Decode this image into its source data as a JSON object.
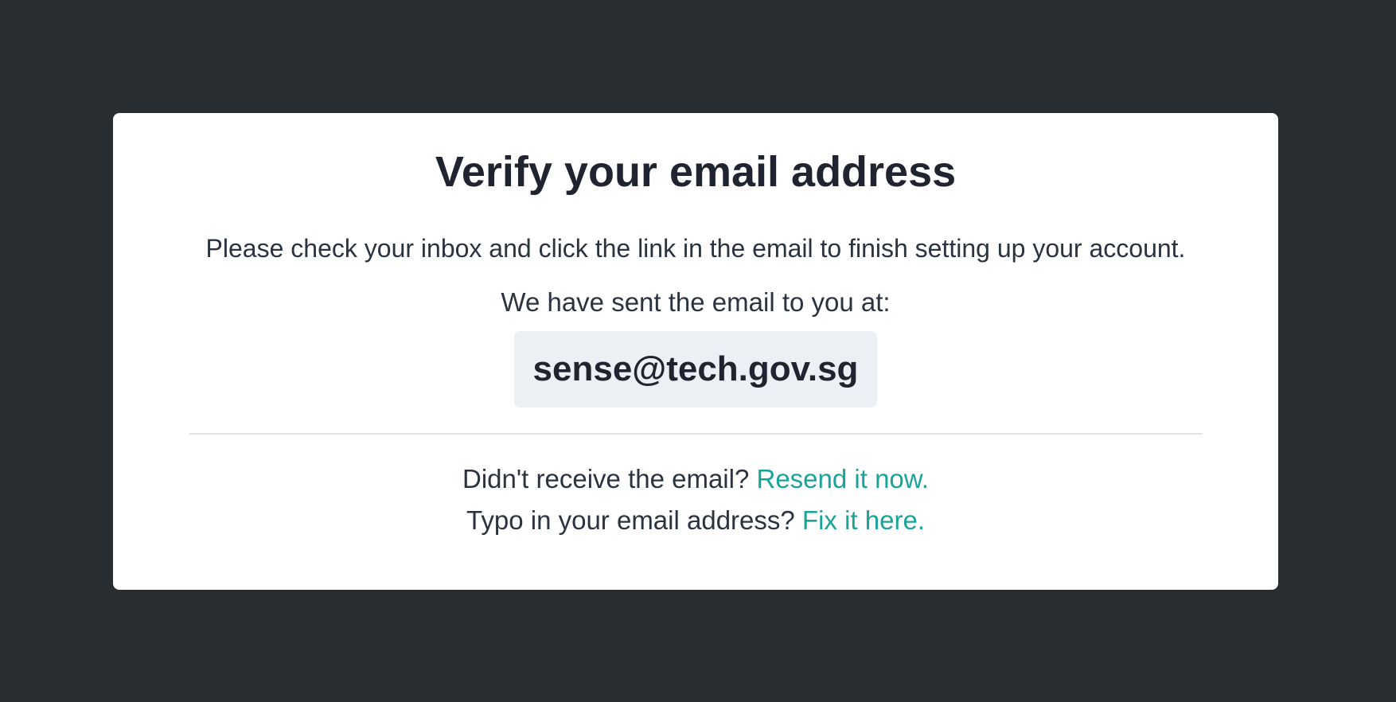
{
  "verify": {
    "title": "Verify your email address",
    "instruction": "Please check your inbox and click the link in the email to finish setting up your account.",
    "sent_label": "We have sent the email to you at:",
    "email": "sense@tech.gov.sg",
    "resend_prompt": "Didn't receive the email?",
    "resend_link": "Resend it now.",
    "fix_prompt": "Typo in your email address?",
    "fix_link": "Fix it here."
  },
  "colors": {
    "background": "#282d32",
    "card": "#ffffff",
    "email_box": "#ecf0f4",
    "link": "#1aa398",
    "text": "#1f2430"
  }
}
